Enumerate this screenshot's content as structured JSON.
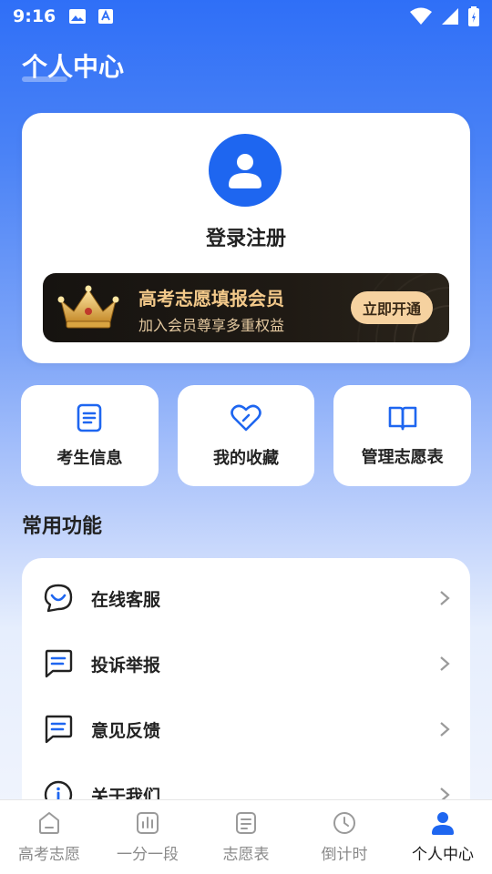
{
  "status": {
    "time": "9:16"
  },
  "header": {
    "title": "个人中心"
  },
  "profile": {
    "login_label": "登录注册"
  },
  "vip": {
    "title": "高考志愿填报会员",
    "subtitle": "加入会员尊享多重权益",
    "button_label": "立即开通"
  },
  "quick_actions": [
    {
      "label": "考生信息",
      "icon": "doc-icon"
    },
    {
      "label": "我的收藏",
      "icon": "heart-icon"
    },
    {
      "label": "管理志愿表",
      "icon": "book-icon"
    }
  ],
  "section": {
    "title": "常用功能"
  },
  "functions": [
    {
      "label": "在线客服",
      "icon": "chat-smile-icon"
    },
    {
      "label": "投诉举报",
      "icon": "chat-lines-icon"
    },
    {
      "label": "意见反馈",
      "icon": "chat-lines-icon"
    },
    {
      "label": "关于我们",
      "icon": "info-icon"
    }
  ],
  "tabs": [
    {
      "label": "高考志愿",
      "active": false
    },
    {
      "label": "一分一段",
      "active": false
    },
    {
      "label": "志愿表",
      "active": false
    },
    {
      "label": "倒计时",
      "active": false
    },
    {
      "label": "个人中心",
      "active": true
    }
  ],
  "colors": {
    "primary": "#1e66f0",
    "vip_gold": "#f3c98a",
    "vip_button": "#f6d2a0"
  }
}
